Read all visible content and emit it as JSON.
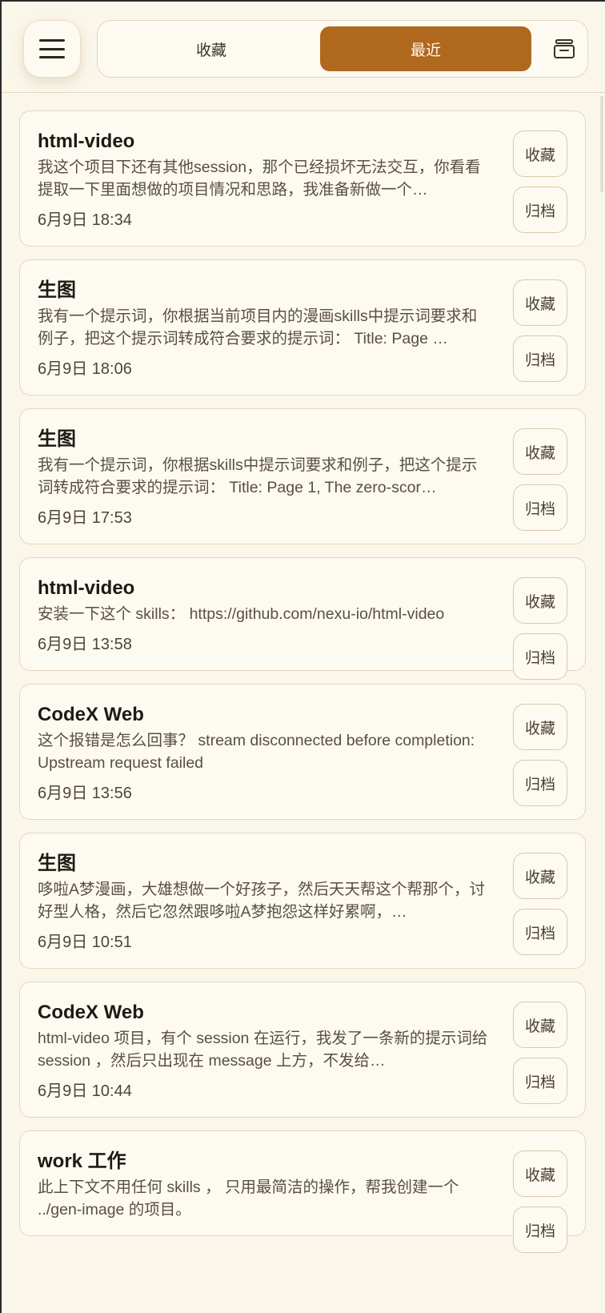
{
  "header": {
    "tabs": [
      {
        "label": "收藏",
        "active": false
      },
      {
        "label": "最近",
        "active": true
      }
    ],
    "accent_color": "#b0681f",
    "archive_icon": "archive-box-icon",
    "menu_icon": "hamburger-menu-icon"
  },
  "sessions": [
    {
      "title": "html-video",
      "snippet": "我这个项目下还有其他session，那个已经损坏无法交互，你看看提取一下里面想做的项目情况和思路，我准备新做一个…",
      "time": "6月9日 18:34",
      "favorite_label": "收藏",
      "archive_label": "归档"
    },
    {
      "title": "生图",
      "snippet": "我有一个提示词，你根据当前项目内的漫画skills中提示词要求和例子，把这个提示词转成符合要求的提示词： Title: Page …",
      "time": "6月9日 18:06",
      "favorite_label": "收藏",
      "archive_label": "归档"
    },
    {
      "title": "生图",
      "snippet": "我有一个提示词，你根据skills中提示词要求和例子，把这个提示词转成符合要求的提示词： Title: Page 1, The zero-scor…",
      "time": "6月9日 17:53",
      "favorite_label": "收藏",
      "archive_label": "归档"
    },
    {
      "title": "html-video",
      "snippet": "安装一下这个 skills： https://github.com/nexu-io/html-video",
      "time": "6月9日 13:58",
      "favorite_label": "收藏",
      "archive_label": "归档"
    },
    {
      "title": "CodeX Web",
      "snippet": "这个报错是怎么回事？ stream disconnected before completion: Upstream request failed",
      "time": "6月9日 13:56",
      "favorite_label": "收藏",
      "archive_label": "归档"
    },
    {
      "title": "生图",
      "snippet": "哆啦A梦漫画，大雄想做一个好孩子，然后天天帮这个帮那个，讨好型人格，然后它忽然跟哆啦A梦抱怨这样好累啊，…",
      "time": "6月9日 10:51",
      "favorite_label": "收藏",
      "archive_label": "归档"
    },
    {
      "title": "CodeX Web",
      "snippet": "html-video 项目，有个 session 在运行，我发了一条新的提示词给 session ，然后只出现在 message 上方，不发给…",
      "time": "6月9日 10:44",
      "favorite_label": "收藏",
      "archive_label": "归档"
    },
    {
      "title": "work  工作",
      "snippet": "此上下文不用任何 skills ， 只用最简洁的操作，帮我创建一个 ../gen-image 的项目。",
      "time": "",
      "favorite_label": "收藏",
      "archive_label": "归档"
    }
  ]
}
